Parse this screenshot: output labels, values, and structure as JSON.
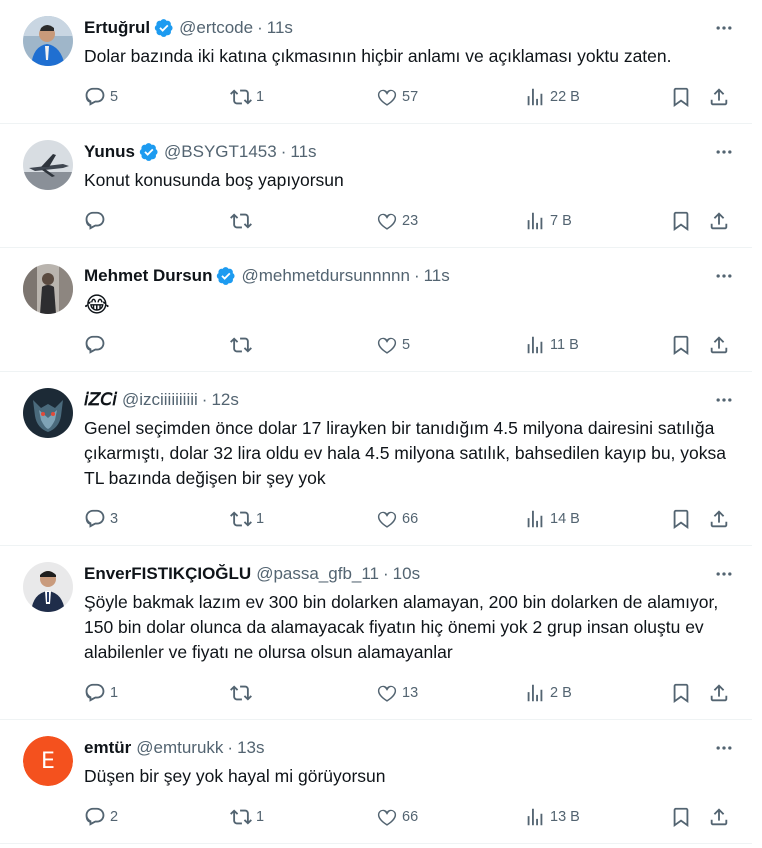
{
  "tweets": [
    {
      "name": "Ertuğrul",
      "verified": true,
      "handle": "@ertcode",
      "time": "11s",
      "text": "Dolar bazında iki katına çıkmasının hiçbir anlamı ve açıklaması yoktu zaten.",
      "replies": "5",
      "retweets": "1",
      "likes": "57",
      "views": "22 B"
    },
    {
      "name": "Yunus",
      "verified": true,
      "handle": "@BSYGT1453",
      "time": "11s",
      "text": "Konut konusunda boş yapıyorsun",
      "replies": "",
      "retweets": "",
      "likes": "23",
      "views": "7 B"
    },
    {
      "name": "Mehmet Dursun",
      "verified": true,
      "handle": "@mehmetdursunnnnn",
      "time": "11s",
      "text": "😂",
      "replies": "",
      "retweets": "",
      "likes": "5",
      "views": "11 B"
    },
    {
      "name": "𝘪𝘡𝘊𝘪",
      "verified": false,
      "handle": "@izciiiiiiiiii",
      "time": "12s",
      "text": "Genel seçimden önce dolar 17 lirayken bir tanıdığım 4.5 milyona dairesini satılığa çıkarmıştı, dolar 32 lira oldu ev hala 4.5 milyona satılık, bahsedilen kayıp bu, yoksa TL bazında değişen bir şey yok",
      "replies": "3",
      "retweets": "1",
      "likes": "66",
      "views": "14 B"
    },
    {
      "name": "EnverFISTIKÇIOĞLU",
      "verified": false,
      "handle": "@passa_gfb_11",
      "time": "10s",
      "text": "Şöyle bakmak lazım ev 300 bin dolarken alamayan, 200 bin dolarken de alamıyor, 150 bin dolar olunca da alamayacak fiyatın hiç önemi yok 2 grup insan oluştu ev alabilenler ve fiyatı ne olursa olsun alamayanlar",
      "replies": "1",
      "retweets": "",
      "likes": "13",
      "views": "2 B"
    },
    {
      "name": "emtür",
      "verified": false,
      "handle": "@emturukk",
      "time": "13s",
      "text": "Düşen bir şey yok hayal mi görüyorsun",
      "replies": "2",
      "retweets": "1",
      "likes": "66",
      "views": "13 B",
      "avatar_letter": "E"
    }
  ],
  "colors": {
    "text_primary": "#0f1419",
    "text_secondary": "#536471",
    "verified_blue": "#1d9bf0",
    "divider": "#eff3f4",
    "letter_avatar_bg": "#f4511e"
  },
  "icons": [
    "more-icon",
    "reply-icon",
    "retweet-icon",
    "like-icon",
    "views-icon",
    "bookmark-icon",
    "share-icon",
    "verified-badge-icon"
  ]
}
